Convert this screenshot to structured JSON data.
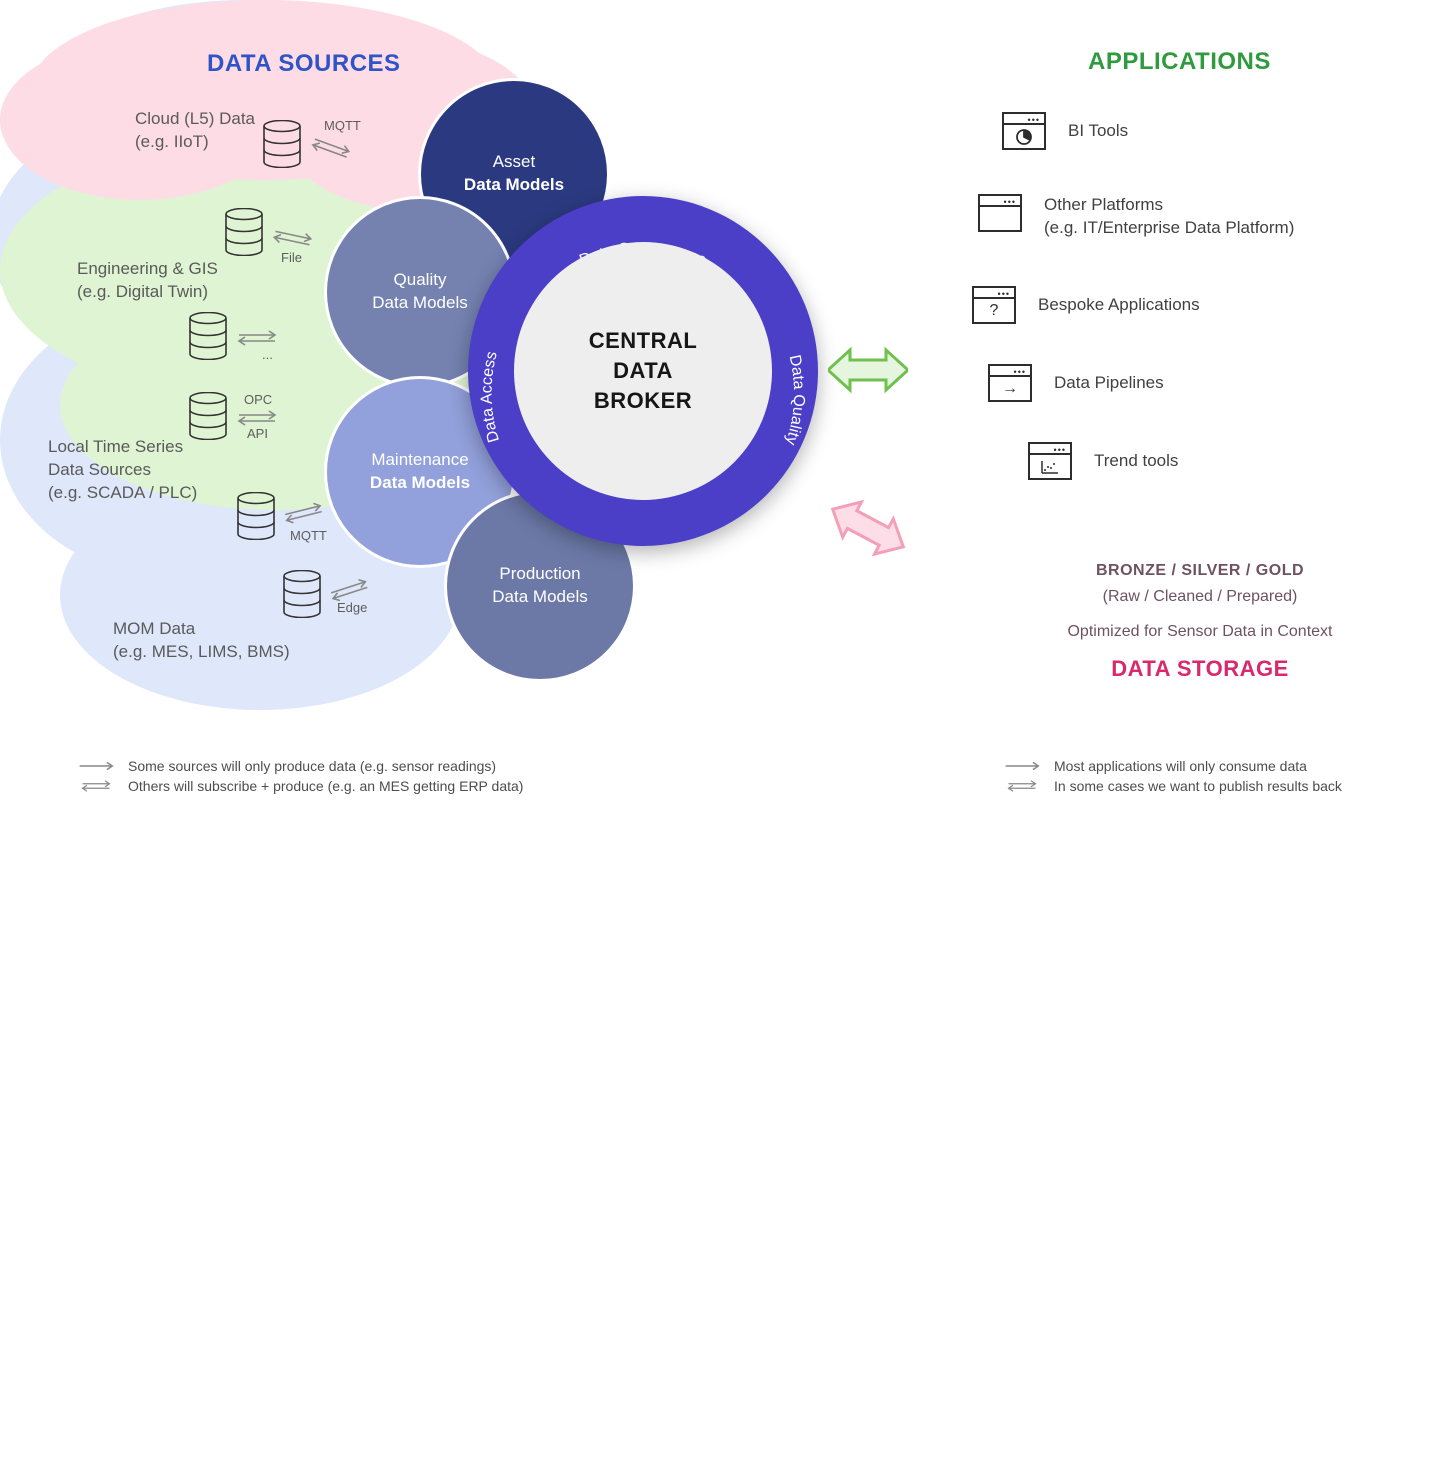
{
  "sources": {
    "title": "DATA SOURCES",
    "items": [
      {
        "label1": "Cloud (L5) Data",
        "label2": "(e.g. IIoT)",
        "proto": "MQTT"
      },
      {
        "label1": "Engineering & GIS",
        "label2": "(e.g. Digital Twin)",
        "proto": "File",
        "proto2": "..."
      },
      {
        "label1": "Local Time Series",
        "label2": "Data Sources",
        "label3": "(e.g. SCADA / PLC)",
        "proto": "OPC",
        "proto2": "API",
        "proto3": "MQTT"
      },
      {
        "label1": "MOM Data",
        "label2": "(e.g. MES, LIMS, BMS)",
        "proto": "Edge"
      }
    ]
  },
  "petals": {
    "asset": {
      "line1": "Asset",
      "line2": "Data Models"
    },
    "quality": {
      "line1": "Quality",
      "line2": "Data Models"
    },
    "maintenance": {
      "line1": "Maintenance",
      "line2": "Data Models"
    },
    "production": {
      "line1": "Production",
      "line2": "Data Models"
    }
  },
  "center": {
    "line1": "CENTRAL",
    "line2": "DATA",
    "line3": "BROKER"
  },
  "ring": {
    "top": "Data Governance",
    "left": "Data Access",
    "right": "Data Quality"
  },
  "apps": {
    "title": "APPLICATIONS",
    "items": [
      {
        "label": "BI Tools"
      },
      {
        "label": "Other Platforms",
        "sub": "(e.g. IT/Enterprise Data Platform)"
      },
      {
        "label": "Bespoke Applications"
      },
      {
        "label": "Data Pipelines"
      },
      {
        "label": "Trend tools"
      }
    ]
  },
  "storage": {
    "tiers": "BRONZE / SILVER / GOLD",
    "tiers_sub": "(Raw / Cleaned / Prepared)",
    "optimized": "Optimized for Sensor Data in Context",
    "title": "DATA STORAGE"
  },
  "legend": {
    "src1": "Some sources will only produce data (e.g. sensor readings)",
    "src2": "Others will subscribe + produce (e.g. an MES getting ERP data)",
    "app1": "Most applications will only consume data",
    "app2": "In some cases we want to publish results back"
  }
}
